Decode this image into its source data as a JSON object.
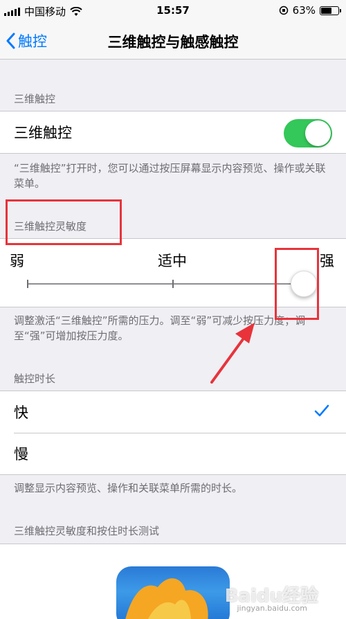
{
  "status_bar": {
    "carrier": "中国移动",
    "time": "15:57",
    "battery": "63%",
    "battery_level": 0.63
  },
  "nav": {
    "back_label": "触控",
    "title": "三维触控与触感触控"
  },
  "section_3d": {
    "header": "三维触控",
    "toggle_label": "三维触控",
    "toggle_on": true,
    "footer": "“三维触控”打开时，您可以通过按压屏幕显示内容预览、操作或关联菜单。"
  },
  "section_sensitivity": {
    "header": "三维触控灵敏度",
    "label_weak": "弱",
    "label_mid": "适中",
    "label_strong": "强",
    "value": 1.0,
    "footer": "调整激活“三维触控”所需的压力。调至“弱”可减少按压力度；调至“强”可增加按压力度。"
  },
  "section_duration": {
    "header": "触控时长",
    "options": [
      {
        "label": "快",
        "selected": true
      },
      {
        "label": "慢",
        "selected": false
      }
    ],
    "footer": "调整显示内容预览、操作和关联菜单所需的时长。"
  },
  "section_test": {
    "header": "三维触控灵敏度和按住时长测试"
  },
  "watermark": {
    "brand": "Baidu经验",
    "url": "jingyan.baidu.com"
  },
  "colors": {
    "accent": "#007aff",
    "toggle_on": "#34c759",
    "annotation": "#e8333b"
  }
}
